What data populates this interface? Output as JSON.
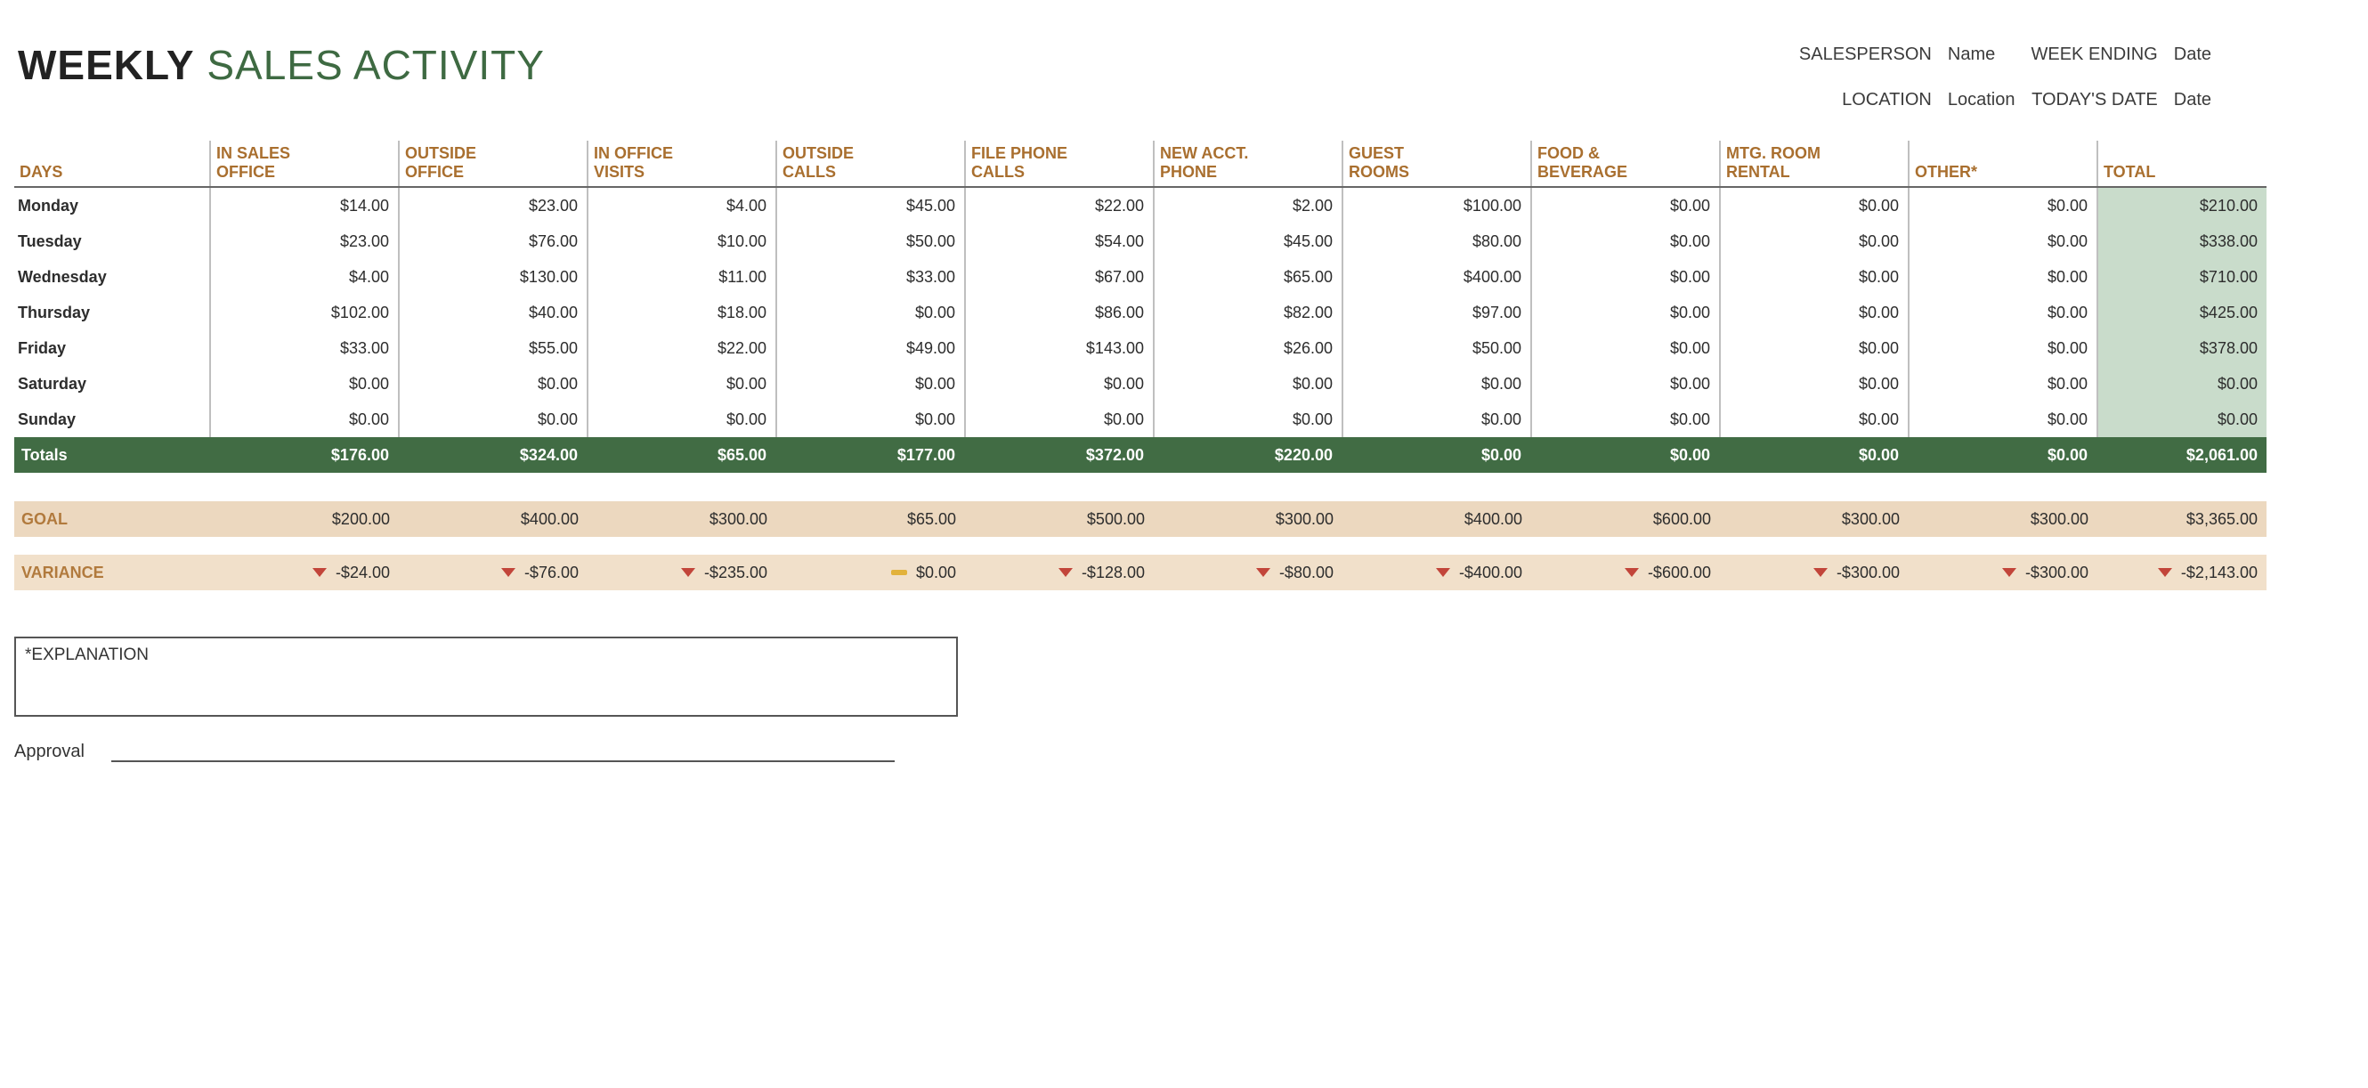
{
  "title": {
    "bold": "WEEKLY",
    "light": "SALES ACTIVITY"
  },
  "meta": {
    "salesperson_label": "SALESPERSON",
    "salesperson_value": "Name",
    "weekending_label": "WEEK ENDING",
    "weekending_value": "Date",
    "location_label": "LOCATION",
    "location_value": "Location",
    "today_label": "TODAY'S DATE",
    "today_value": "Date"
  },
  "columns": [
    "DAYS",
    "IN SALES OFFICE",
    "OUTSIDE OFFICE",
    "IN OFFICE VISITS",
    "OUTSIDE CALLS",
    "FILE PHONE CALLS",
    "NEW ACCT. PHONE",
    "GUEST ROOMS",
    "FOOD & BEVERAGE",
    "MTG. ROOM RENTAL",
    "OTHER*",
    "TOTAL"
  ],
  "rows": [
    {
      "day": "Monday",
      "v": [
        "$14.00",
        "$23.00",
        "$4.00",
        "$45.00",
        "$22.00",
        "$2.00",
        "$100.00",
        "$0.00",
        "$0.00",
        "$0.00",
        "$210.00"
      ]
    },
    {
      "day": "Tuesday",
      "v": [
        "$23.00",
        "$76.00",
        "$10.00",
        "$50.00",
        "$54.00",
        "$45.00",
        "$80.00",
        "$0.00",
        "$0.00",
        "$0.00",
        "$338.00"
      ]
    },
    {
      "day": "Wednesday",
      "v": [
        "$4.00",
        "$130.00",
        "$11.00",
        "$33.00",
        "$67.00",
        "$65.00",
        "$400.00",
        "$0.00",
        "$0.00",
        "$0.00",
        "$710.00"
      ]
    },
    {
      "day": "Thursday",
      "v": [
        "$102.00",
        "$40.00",
        "$18.00",
        "$0.00",
        "$86.00",
        "$82.00",
        "$97.00",
        "$0.00",
        "$0.00",
        "$0.00",
        "$425.00"
      ]
    },
    {
      "day": "Friday",
      "v": [
        "$33.00",
        "$55.00",
        "$22.00",
        "$49.00",
        "$143.00",
        "$26.00",
        "$50.00",
        "$0.00",
        "$0.00",
        "$0.00",
        "$378.00"
      ]
    },
    {
      "day": "Saturday",
      "v": [
        "$0.00",
        "$0.00",
        "$0.00",
        "$0.00",
        "$0.00",
        "$0.00",
        "$0.00",
        "$0.00",
        "$0.00",
        "$0.00",
        "$0.00"
      ]
    },
    {
      "day": "Sunday",
      "v": [
        "$0.00",
        "$0.00",
        "$0.00",
        "$0.00",
        "$0.00",
        "$0.00",
        "$0.00",
        "$0.00",
        "$0.00",
        "$0.00",
        "$0.00"
      ]
    }
  ],
  "totals": {
    "label": "Totals",
    "v": [
      "$176.00",
      "$324.00",
      "$65.00",
      "$177.00",
      "$372.00",
      "$220.00",
      "$0.00",
      "$0.00",
      "$0.00",
      "$0.00",
      "$2,061.00"
    ]
  },
  "goal": {
    "label": "GOAL",
    "v": [
      "$200.00",
      "$400.00",
      "$300.00",
      "$65.00",
      "$500.00",
      "$300.00",
      "$400.00",
      "$600.00",
      "$300.00",
      "$300.00",
      "$3,365.00"
    ]
  },
  "variance": {
    "label": "VARIANCE",
    "v": [
      "-$24.00",
      "-$76.00",
      "-$235.00",
      "$0.00",
      "-$128.00",
      "-$80.00",
      "-$400.00",
      "-$600.00",
      "-$300.00",
      "-$300.00",
      "-$2,143.00"
    ],
    "dir": [
      "down",
      "down",
      "down",
      "flat",
      "down",
      "down",
      "down",
      "down",
      "down",
      "down",
      "down"
    ]
  },
  "footer": {
    "explanation_label": "*EXPLANATION",
    "approval_label": "Approval"
  },
  "chart_data": {
    "type": "table",
    "title": "Weekly Sales Activity",
    "columns": [
      "IN SALES OFFICE",
      "OUTSIDE OFFICE",
      "IN OFFICE VISITS",
      "OUTSIDE CALLS",
      "FILE PHONE CALLS",
      "NEW ACCT. PHONE",
      "GUEST ROOMS",
      "FOOD & BEVERAGE",
      "MTG. ROOM RENTAL",
      "OTHER*",
      "TOTAL"
    ],
    "rows": {
      "Monday": [
        14,
        23,
        4,
        45,
        22,
        2,
        100,
        0,
        0,
        0,
        210
      ],
      "Tuesday": [
        23,
        76,
        10,
        50,
        54,
        45,
        80,
        0,
        0,
        0,
        338
      ],
      "Wednesday": [
        4,
        130,
        11,
        33,
        67,
        65,
        400,
        0,
        0,
        0,
        710
      ],
      "Thursday": [
        102,
        40,
        18,
        0,
        86,
        82,
        97,
        0,
        0,
        0,
        425
      ],
      "Friday": [
        33,
        55,
        22,
        49,
        143,
        26,
        50,
        0,
        0,
        0,
        378
      ],
      "Saturday": [
        0,
        0,
        0,
        0,
        0,
        0,
        0,
        0,
        0,
        0,
        0
      ],
      "Sunday": [
        0,
        0,
        0,
        0,
        0,
        0,
        0,
        0,
        0,
        0,
        0
      ],
      "Totals": [
        176,
        324,
        65,
        177,
        372,
        220,
        0,
        0,
        0,
        0,
        2061
      ],
      "Goal": [
        200,
        400,
        300,
        65,
        500,
        300,
        400,
        600,
        300,
        300,
        3365
      ],
      "Variance": [
        -24,
        -76,
        -235,
        0,
        -128,
        -80,
        -400,
        -600,
        -300,
        -300,
        -2143
      ]
    }
  }
}
